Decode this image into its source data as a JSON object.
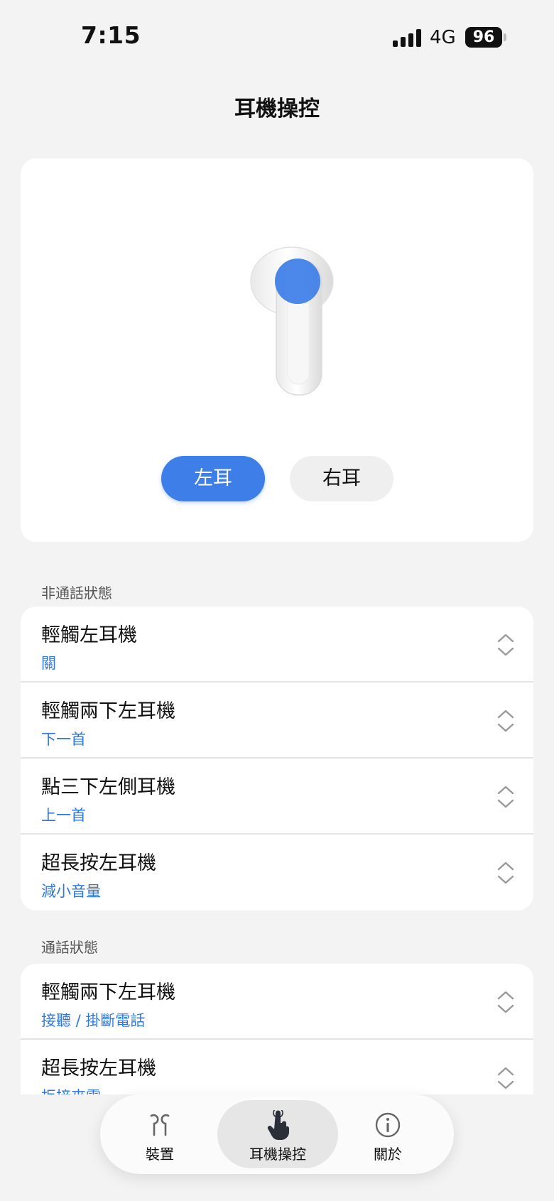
{
  "status_bar": {
    "time": "7:15",
    "network": "4G",
    "battery": "96"
  },
  "page": {
    "title": "耳機操控"
  },
  "ear_selector": {
    "left_label": "左耳",
    "right_label": "右耳",
    "selected": "左耳"
  },
  "sections": {
    "non_call": {
      "label": "非通話狀態",
      "items": [
        {
          "title": "輕觸左耳機",
          "value": "關"
        },
        {
          "title": "輕觸兩下左耳機",
          "value": "下一首"
        },
        {
          "title": "點三下左側耳機",
          "value": "上一首"
        },
        {
          "title": "超長按左耳機",
          "value": "減小音量"
        }
      ]
    },
    "call": {
      "label": "通話狀態",
      "items": [
        {
          "title": "輕觸兩下左耳機",
          "value": "接聽 / 掛斷電話"
        },
        {
          "title": "超長按左耳機",
          "value": "拒接來電"
        }
      ]
    }
  },
  "bottom_nav": {
    "items": [
      {
        "label": "裝置",
        "icon": "earbuds-icon"
      },
      {
        "label": "耳機操控",
        "icon": "tap-hand-icon",
        "active": true
      },
      {
        "label": "關於",
        "icon": "info-icon"
      }
    ]
  },
  "colors": {
    "accent": "#3d7ee8",
    "value_text": "#2f78e4",
    "background": "#f3f3f3"
  }
}
